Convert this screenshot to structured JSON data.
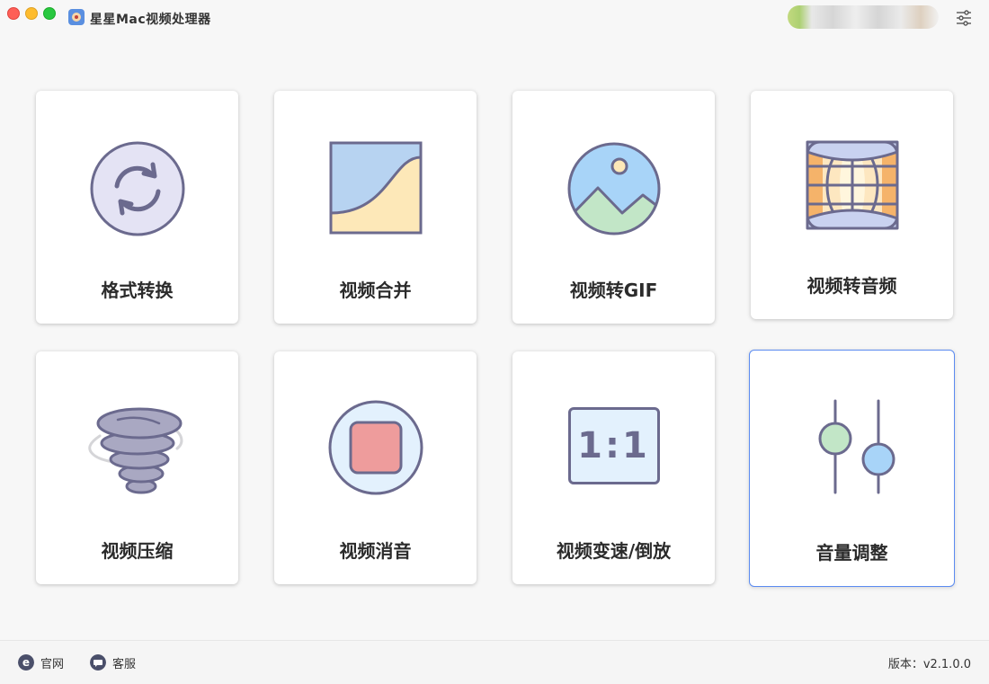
{
  "window": {
    "title": "星星Mac视频处理器"
  },
  "tools": [
    {
      "label": "格式转换",
      "icon": "convert-cycle-icon"
    },
    {
      "label": "视频合并",
      "icon": "merge-image-icon"
    },
    {
      "label": "视频转GIF",
      "icon": "picture-circle-icon"
    },
    {
      "label": "视频转音频",
      "icon": "globe-film-icon"
    },
    {
      "label": "视频压缩",
      "icon": "tornado-compress-icon"
    },
    {
      "label": "视频消音",
      "icon": "stop-mute-icon"
    },
    {
      "label": "视频变速/倒放",
      "icon": "ratio-1-1-icon"
    },
    {
      "label": "音量调整",
      "icon": "sliders-volume-icon"
    }
  ],
  "ratio_text": "1:1",
  "footer": {
    "website": "官网",
    "support": "客服",
    "version": "版本：v2.1.0.0"
  },
  "colors": {
    "accent": "#5b8bf0",
    "icon_stroke": "#6b6a8e",
    "card_bg": "#ffffff"
  }
}
